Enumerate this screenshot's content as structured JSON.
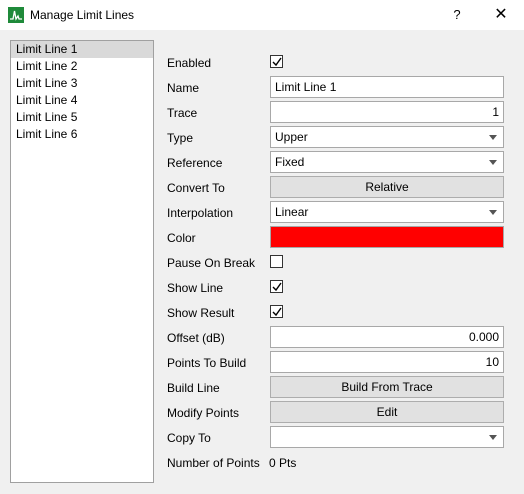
{
  "window": {
    "title": "Manage Limit Lines",
    "help_label": "?",
    "close_label": "✕",
    "icon": "spectrum-icon"
  },
  "list": {
    "items": [
      "Limit Line 1",
      "Limit Line 2",
      "Limit Line 3",
      "Limit Line 4",
      "Limit Line 5",
      "Limit Line 6"
    ],
    "selected": "Limit Line 1"
  },
  "form": {
    "enabled": {
      "label": "Enabled",
      "checked": true
    },
    "name": {
      "label": "Name",
      "value": "Limit Line 1"
    },
    "trace": {
      "label": "Trace",
      "value": "1"
    },
    "type": {
      "label": "Type",
      "value": "Upper"
    },
    "reference": {
      "label": "Reference",
      "value": "Fixed"
    },
    "convert_to": {
      "label": "Convert To",
      "button": "Relative"
    },
    "interpolation": {
      "label": "Interpolation",
      "value": "Linear"
    },
    "color": {
      "label": "Color",
      "value": "#ff0000"
    },
    "pause_on_break": {
      "label": "Pause On Break",
      "checked": false
    },
    "show_line": {
      "label": "Show Line",
      "checked": true
    },
    "show_result": {
      "label": "Show Result",
      "checked": true
    },
    "offset": {
      "label": "Offset (dB)",
      "value": "0.000"
    },
    "points_to_build": {
      "label": "Points To Build",
      "value": "10"
    },
    "build_line": {
      "label": "Build Line",
      "button": "Build From Trace"
    },
    "modify_points": {
      "label": "Modify Points",
      "button": "Edit"
    },
    "copy_to": {
      "label": "Copy To",
      "value": ""
    },
    "number_of_points": {
      "label": "Number of Points",
      "value": "0 Pts"
    }
  }
}
